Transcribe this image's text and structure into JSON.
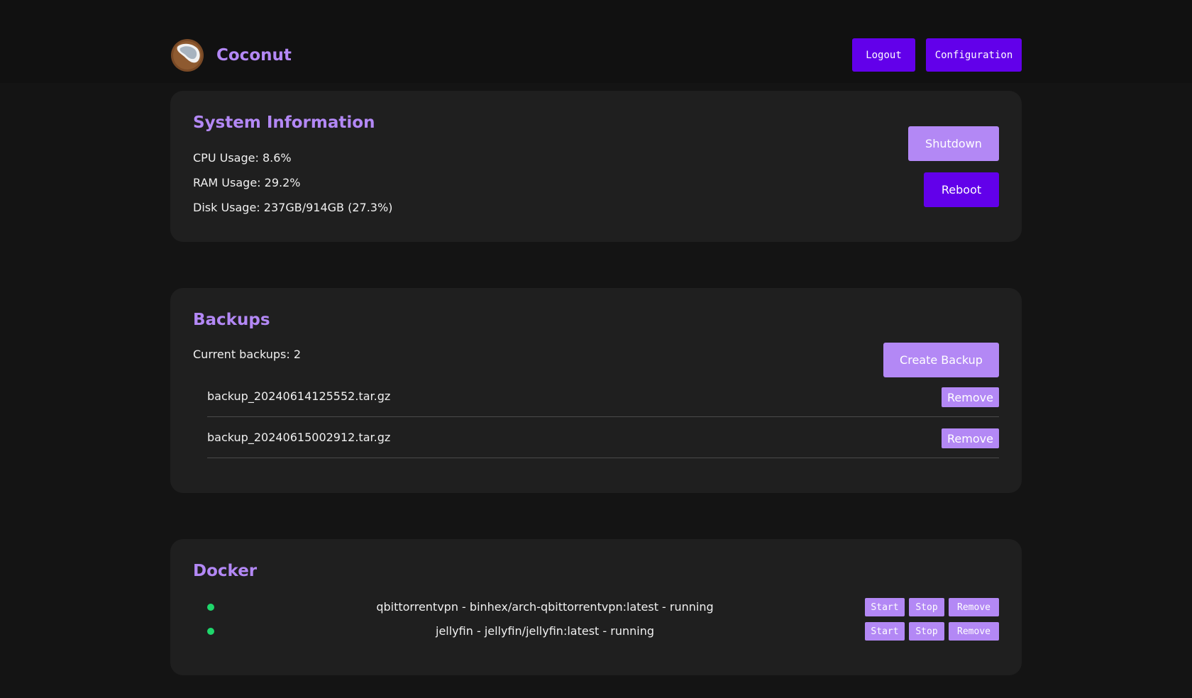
{
  "header": {
    "brand": "Coconut",
    "logo_icon": "coconut-icon",
    "logout_label": "Logout",
    "config_label": "Configuration"
  },
  "system": {
    "title": "System Information",
    "cpu": "CPU Usage: 8.6%",
    "ram": "RAM Usage: 29.2%",
    "disk": "Disk Usage: 237GB/914GB (27.3%)",
    "shutdown_label": "Shutdown",
    "reboot_label": "Reboot"
  },
  "backups": {
    "title": "Backups",
    "count_text": "Current backups: 2",
    "create_label": "Create Backup",
    "items": [
      {
        "name": "backup_20240614125552.tar.gz",
        "remove_label": "Remove"
      },
      {
        "name": "backup_20240615002912.tar.gz",
        "remove_label": "Remove"
      }
    ]
  },
  "docker": {
    "title": "Docker",
    "containers": [
      {
        "text": "qbittorrentvpn - binhex/arch-qbittorrentvpn:latest - running",
        "status_color": "#1fd66b",
        "start_label": "Start",
        "stop_label": "Stop",
        "remove_label": "Remove"
      },
      {
        "text": "jellyfin - jellyfin/jellyfin:latest - running",
        "status_color": "#1fd66b",
        "start_label": "Start",
        "stop_label": "Stop",
        "remove_label": "Remove"
      }
    ]
  },
  "colors": {
    "accent": "#b388f5",
    "primary": "#6200ea",
    "background": "#141414",
    "card": "#1f1f1f"
  }
}
